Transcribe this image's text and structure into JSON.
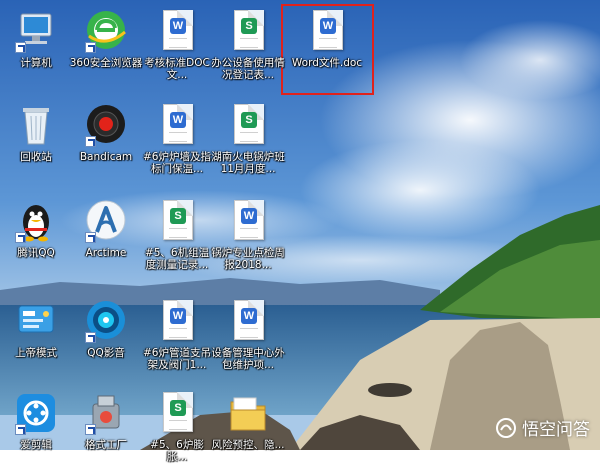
{
  "desktop": {
    "icons": [
      {
        "label": "计算机",
        "icon": "computer-icon"
      },
      {
        "label": "360安全浏览器",
        "icon": "360-browser-icon"
      },
      {
        "label": "考核标准DOC 文...",
        "icon": "word-doc-icon"
      },
      {
        "label": "办公设备使用情况登记表...",
        "icon": "excel-sheet-icon"
      },
      {
        "label": "Word文件.doc",
        "icon": "word-doc-icon"
      },
      {
        "label": "回收站",
        "icon": "recycle-bin-icon"
      },
      {
        "label": "Bandicam",
        "icon": "bandicam-icon"
      },
      {
        "label": "#6炉炉墙及指标门保温...",
        "icon": "word-doc-icon"
      },
      {
        "label": "湖南火电锅炉班11月月度...",
        "icon": "excel-sheet-icon"
      },
      {
        "label": "腾讯QQ",
        "icon": "qq-penguin-icon"
      },
      {
        "label": "Arctime",
        "icon": "arctime-icon"
      },
      {
        "label": "#5、6机组温度测量记录...",
        "icon": "excel-sheet-icon"
      },
      {
        "label": "锅炉专业点检周报2018...",
        "icon": "word-doc-icon"
      },
      {
        "label": "上帝模式",
        "icon": "control-panel-icon"
      },
      {
        "label": "QQ影音",
        "icon": "qq-player-icon"
      },
      {
        "label": "#6炉管道支吊架及阀门1...",
        "icon": "word-doc-icon"
      },
      {
        "label": "设备管理中心外包维护项...",
        "icon": "word-doc-icon"
      },
      {
        "label": "爱剪辑",
        "icon": "video-editor-icon"
      },
      {
        "label": "格式工厂",
        "icon": "format-factory-icon"
      },
      {
        "label": "#5、6炉膨胀...",
        "icon": "excel-sheet-icon"
      },
      {
        "label": "风险预控、隐...",
        "icon": "folder-icon"
      }
    ]
  },
  "watermark": {
    "text": "悟空问答"
  },
  "colors": {
    "selection": "#e0221c",
    "word": "#2e6cd1",
    "excel": "#1f9a55",
    "sky": "#3f79c4"
  }
}
